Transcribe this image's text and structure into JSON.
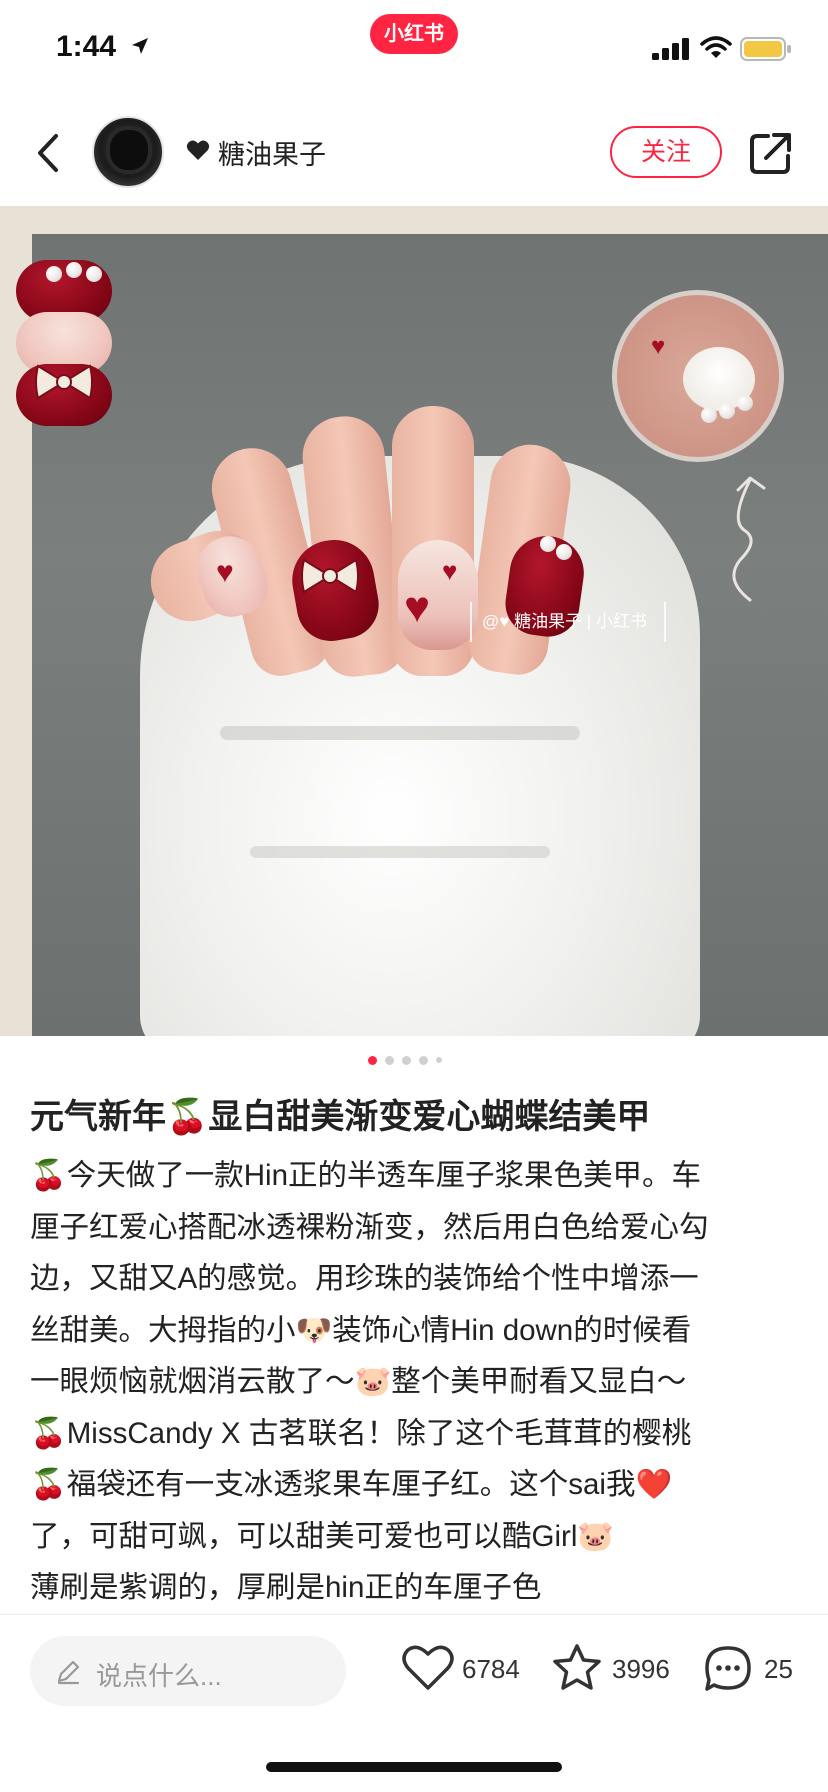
{
  "status_bar": {
    "time": "1:44",
    "brand": "小红书"
  },
  "header": {
    "author_name": "糖油果子",
    "follow_label": "关注"
  },
  "photo": {
    "watermark_author": "@♥ 糖油果子",
    "watermark_brand": "小红书"
  },
  "carousel": {
    "page_count": 5,
    "active_index": 0
  },
  "post": {
    "title": "元气新年🍒显白甜美渐变爱心蝴蝶结美甲",
    "lines": [
      "🍒今天做了一款Hin正的半透车厘子浆果色美甲。车",
      "厘子红爱心搭配冰透裸粉渐变，然后用白色给爱心勾",
      "边，又甜又A的感觉。用珍珠的装饰给个性中增添一",
      "丝甜美。大拇指的小🐶装饰心情Hin down的时候看",
      "一眼烦恼就烟消云散了～🐷整个美甲耐看又显白～",
      "🍒MissCandy X 古茗联名！除了这个毛茸茸的樱桃",
      "🍒福袋还有一支冰透浆果车厘子红。这个sai我❤️",
      "了，可甜可飒，可以甜美可爱也可以酷Girl🐷",
      "薄刷是紫调的，厚刷是hin正的车厘子色"
    ]
  },
  "bottom_bar": {
    "comment_placeholder": "说点什么...",
    "likes": "6784",
    "stars": "3996",
    "comments": "25"
  },
  "colors": {
    "brand_red": "#ff2442",
    "nail_red": "#8f0a1c",
    "nail_pink": "#f0c7c0"
  }
}
